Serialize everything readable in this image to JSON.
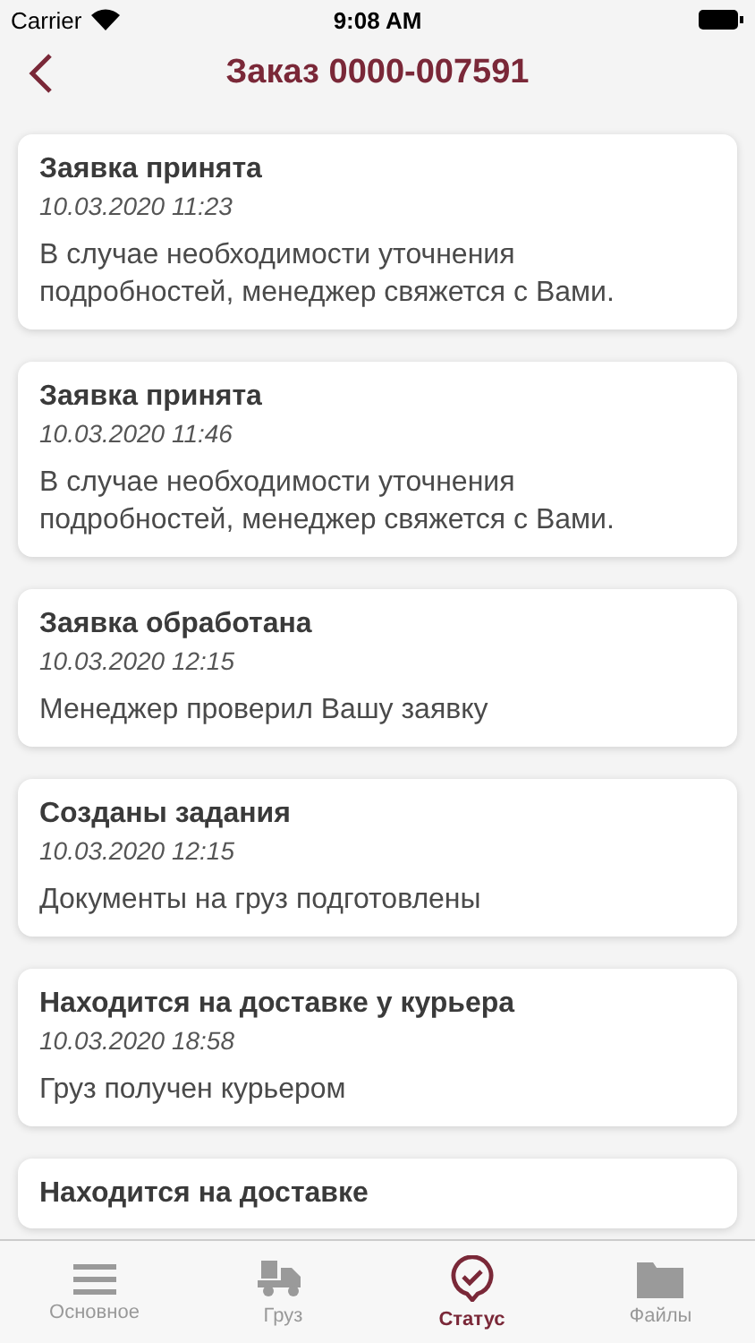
{
  "status_bar": {
    "carrier": "Carrier",
    "time": "9:08 AM"
  },
  "nav": {
    "title": "Заказ 0000-007591"
  },
  "events": [
    {
      "title": "Заявка принята",
      "date": "10.03.2020 11:23",
      "text": "В случае необходимости уточнения подробностей, менеджер свяжется с Вами."
    },
    {
      "title": "Заявка принята",
      "date": "10.03.2020 11:46",
      "text": "В случае необходимости уточнения подробностей, менеджер свяжется с Вами."
    },
    {
      "title": "Заявка обработана",
      "date": "10.03.2020 12:15",
      "text": "Менеджер проверил Вашу заявку"
    },
    {
      "title": "Созданы задания",
      "date": "10.03.2020 12:15",
      "text": "Документы на груз подготовлены"
    },
    {
      "title": "Находится на доставке у курьера",
      "date": "10.03.2020 18:58",
      "text": "Груз получен курьером"
    },
    {
      "title": "Находится на доставке"
    }
  ],
  "tabs": [
    {
      "label": "Основное",
      "kind": "menu",
      "selected": false
    },
    {
      "label": "Груз",
      "kind": "truck",
      "selected": false
    },
    {
      "label": "Статус",
      "kind": "status",
      "selected": true
    },
    {
      "label": "Файлы",
      "kind": "folder",
      "selected": false
    }
  ]
}
